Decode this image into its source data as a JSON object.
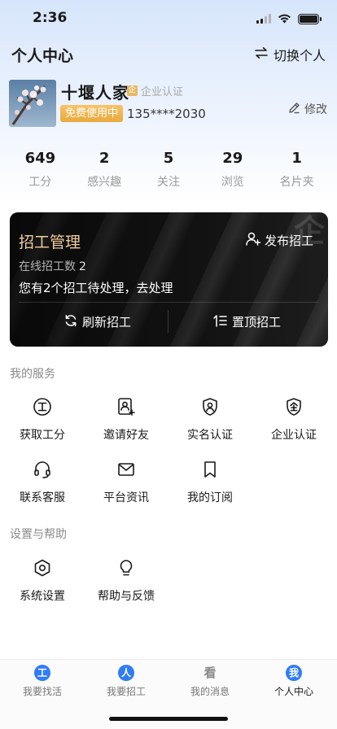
{
  "status_bar": {
    "time": "2:36"
  },
  "header": {
    "title": "个人中心",
    "switch_label": "切换个人"
  },
  "profile": {
    "name": "十堰人家",
    "cert_label": "企业认证",
    "cert_icon_text": "企",
    "badge": "免费使用中",
    "phone": "135****2030",
    "edit_label": "修改"
  },
  "stats": [
    {
      "value": "649",
      "label": "工分"
    },
    {
      "value": "2",
      "label": "感兴趣"
    },
    {
      "value": "5",
      "label": "关注"
    },
    {
      "value": "29",
      "label": "浏览"
    },
    {
      "value": "1",
      "label": "名片夹"
    }
  ],
  "recruit_card": {
    "title": "招工管理",
    "publish_label": "发布招工",
    "online_label": "在线招工数",
    "online_count": "2",
    "pending_text": "您有2个招工待处理，去处理",
    "refresh_label": "刷新招工",
    "top_label": "置顶招工",
    "deco_text": "企"
  },
  "services": {
    "title": "我的服务",
    "items": [
      {
        "label": "获取工分",
        "icon": "coin-icon"
      },
      {
        "label": "邀请好友",
        "icon": "invite-icon"
      },
      {
        "label": "实名认证",
        "icon": "id-verify-icon"
      },
      {
        "label": "企业认证",
        "icon": "enterprise-icon"
      },
      {
        "label": "联系客服",
        "icon": "headset-icon"
      },
      {
        "label": "平台资讯",
        "icon": "mail-icon"
      },
      {
        "label": "我的订阅",
        "icon": "bookmark-icon"
      }
    ],
    "coin_glyph": "工",
    "enterprise_glyph": "企"
  },
  "settings": {
    "title": "设置与帮助",
    "items": [
      {
        "label": "系统设置",
        "icon": "hexagon-settings-icon"
      },
      {
        "label": "帮助与反馈",
        "icon": "bulb-icon"
      }
    ]
  },
  "tabbar": {
    "items": [
      {
        "label": "我要找活",
        "glyph": "工",
        "color": "#2f7cf6"
      },
      {
        "label": "我要招工",
        "glyph": "人",
        "color": "#2f7cf6"
      },
      {
        "label": "我的消息",
        "glyph": "看",
        "color": "#9a9a9a"
      },
      {
        "label": "个人中心",
        "glyph": "我",
        "color": "#2f7cf6"
      }
    ],
    "active_index": 3
  },
  "colors": {
    "accent_blue": "#2f7cf6",
    "gold": "#f1cf9c",
    "badge_orange": "#e9a93c"
  }
}
